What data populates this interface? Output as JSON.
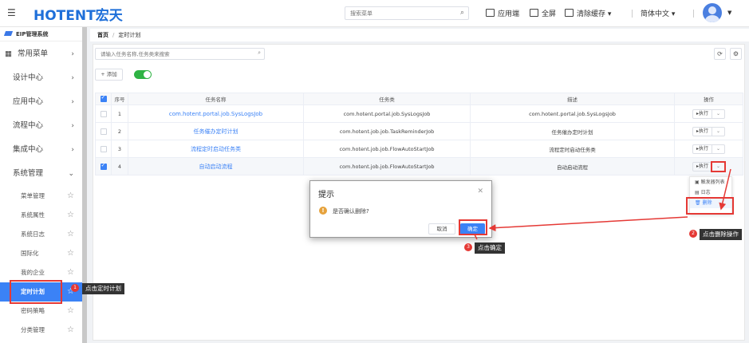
{
  "header": {
    "logo_text": "HOTENT宏天",
    "search_placeholder": "搜索菜单",
    "app_label": "应用端",
    "fullscreen_label": "全屏",
    "clear_cache_label": "清除缓存",
    "language_label": "简体中文"
  },
  "sidebar": {
    "system_name": "EIP管理系统",
    "favorites_label": "常用菜单",
    "menus": [
      "设计中心",
      "应用中心",
      "流程中心",
      "集成中心",
      "系统管理"
    ],
    "sub_items": [
      "菜单管理",
      "系统属性",
      "系统日志",
      "国际化",
      "我的企业",
      "定时计划",
      "密码策略",
      "分类管理"
    ]
  },
  "breadcrumb": {
    "home": "首页",
    "sep": "/",
    "current": "定时计划"
  },
  "toolbar": {
    "search_placeholder": "请输入任务名称,任务类来搜索",
    "add_label": "+ 添加"
  },
  "table": {
    "headers": [
      "序号",
      "任务名称",
      "任务类",
      "描述",
      "操作"
    ],
    "rows": [
      {
        "no": "1",
        "name": "com.hotent.portal.job.SysLogsJob",
        "cls": "com.hotent.portal.job.SysLogsJob",
        "desc": "com.hotent.portal.job.SysLogsJob",
        "checked": false
      },
      {
        "no": "2",
        "name": "任务催办定时计划",
        "cls": "com.hotent.job.job.TaskReminderJob",
        "desc": "任务催办定时计划",
        "checked": false
      },
      {
        "no": "3",
        "name": "流程定时启动任务类",
        "cls": "com.hotent.job.job.FlowAutoStartJob",
        "desc": "流程定时启动任务类",
        "checked": false
      },
      {
        "no": "4",
        "name": "自动启动流程",
        "cls": "com.hotent.job.job.FlowAutoStartJob",
        "desc": "自动启动流程",
        "checked": true
      }
    ],
    "exec_label": "▸执行"
  },
  "dropdown": {
    "items": [
      "触发器列表",
      "日志",
      "删除"
    ]
  },
  "modal": {
    "title": "提示",
    "message": "是否确认删除?",
    "cancel_label": "取消",
    "ok_label": "确定"
  },
  "annotations": {
    "step1": {
      "num": "1",
      "text": "点击定时计划"
    },
    "step2": {
      "num": "2",
      "text": "点击删除操作"
    },
    "step3": {
      "num": "3",
      "text": "点击确定"
    }
  },
  "colors": {
    "primary": "#3b82f6",
    "annotation_red": "#e53935",
    "toggle_green": "#2fb344"
  }
}
